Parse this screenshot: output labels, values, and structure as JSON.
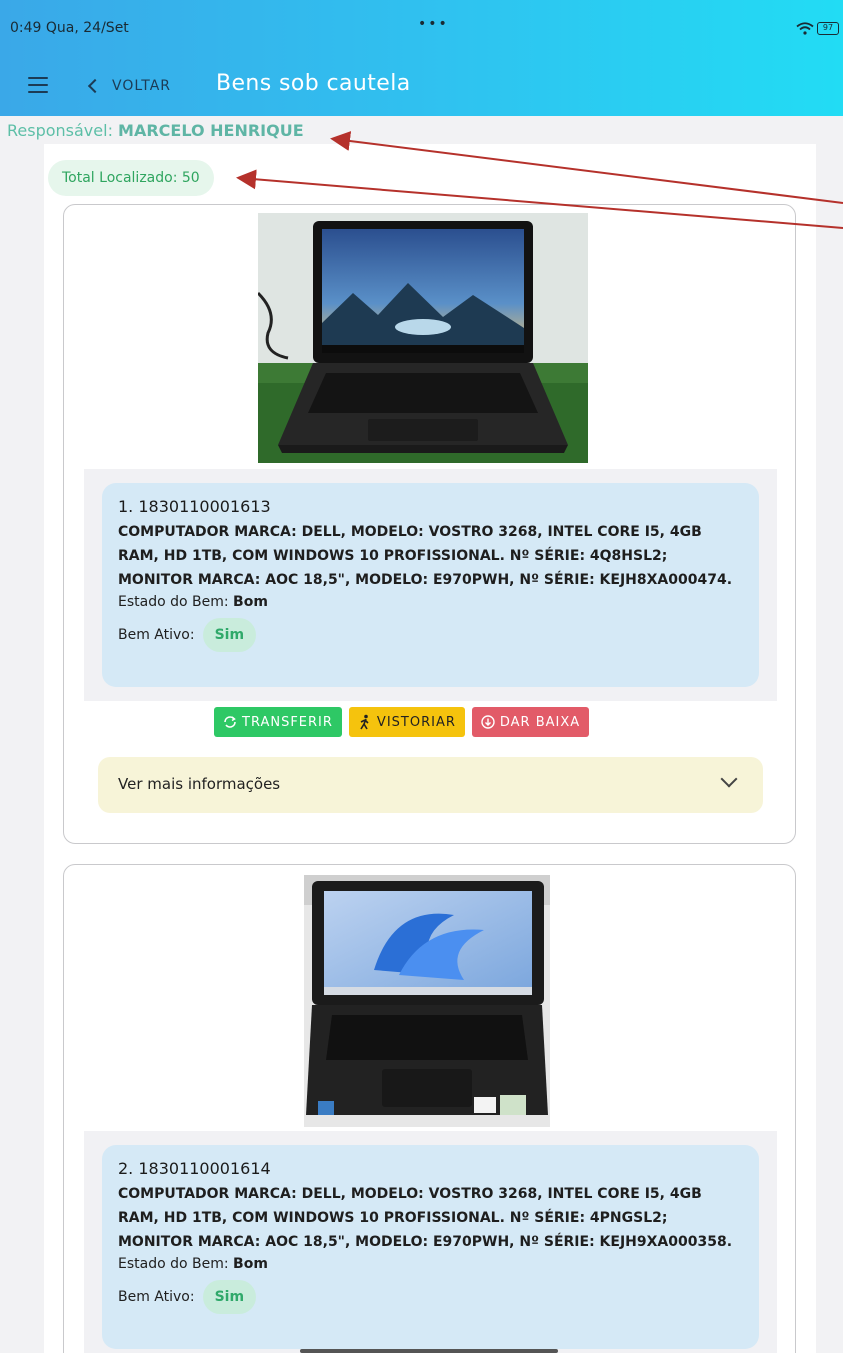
{
  "status": {
    "time": "0:49",
    "date": "Qua, 24/Set",
    "dots": "•••",
    "battery": "97"
  },
  "appbar": {
    "back_label": "VOLTAR",
    "title": "Bens sob cautela"
  },
  "responsavel": {
    "label": "Responsável:",
    "name": "MARCELO HENRIQUE"
  },
  "total": "Total Localizado: 50",
  "labels": {
    "estado": "Estado do Bem:",
    "ativo": "Bem Ativo:",
    "ver_mais": "Ver mais informações",
    "transferir": "TRANSFERIR",
    "vistoriar": "VISTORIAR",
    "baixa": "DAR BAIXA"
  },
  "items": [
    {
      "title": "1. 1830110001613",
      "description": "COMPUTADOR MARCA: DELL, MODELO: VOSTRO 3268, INTEL CORE I5, 4GB RAM, HD 1TB, COM WINDOWS 10 PROFISSIONAL. Nº SÉRIE: 4Q8HSL2; MONITOR MARCA: AOC 18,5\", MODELO: E970PWH, Nº SÉRIE: KEJH8XA000474.",
      "estado": "Bom",
      "ativo": "Sim"
    },
    {
      "title": "2. 1830110001614",
      "description": "COMPUTADOR MARCA: DELL, MODELO: VOSTRO 3268, INTEL CORE I5, 4GB RAM, HD 1TB, COM WINDOWS 10 PROFISSIONAL. Nº SÉRIE: 4PNGSL2; MONITOR MARCA: AOC 18,5\", MODELO: E970PWH, Nº SÉRIE: KEJH9XA000358.",
      "estado": "Bom",
      "ativo": "Sim"
    }
  ],
  "colors": {
    "header_start": "#3aa8e8",
    "header_end": "#22dcf4",
    "annotation_arrow": "#b5312b"
  }
}
